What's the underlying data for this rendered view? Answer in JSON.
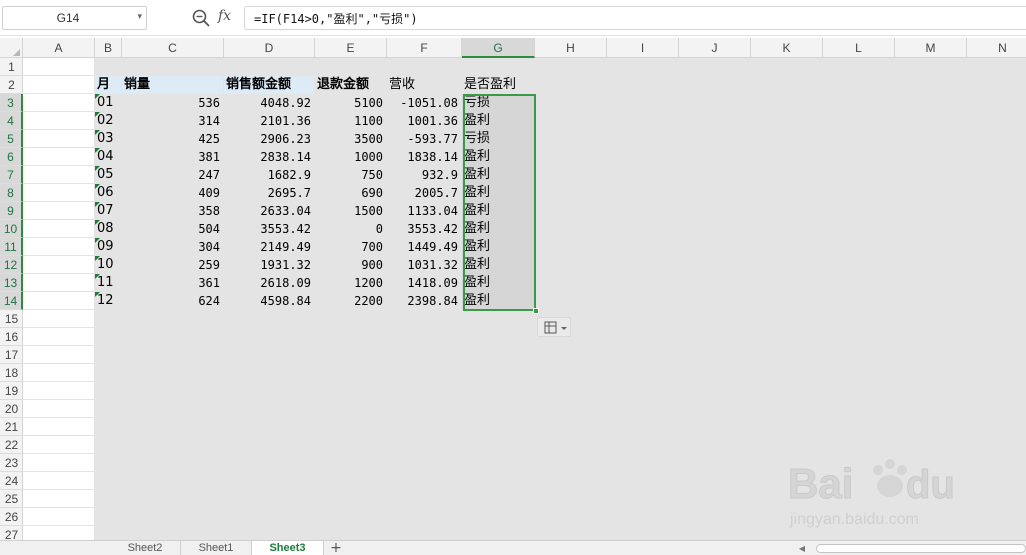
{
  "formula_bar": {
    "name_box": "G14",
    "fx_label": "fx",
    "formula": "=IF(F14>0,\"盈利\",\"亏损\")"
  },
  "columns": [
    "A",
    "B",
    "C",
    "D",
    "E",
    "F",
    "G",
    "H",
    "I",
    "J",
    "K",
    "L",
    "M",
    "N"
  ],
  "rows": [
    "1",
    "2",
    "3",
    "4",
    "5",
    "6",
    "7",
    "8",
    "9",
    "10",
    "11",
    "12",
    "13",
    "14",
    "15",
    "16",
    "17",
    "18",
    "19",
    "20",
    "21",
    "22",
    "23",
    "24",
    "25",
    "26",
    "27"
  ],
  "selected": {
    "column": "G",
    "rows": [
      "3",
      "4",
      "5",
      "6",
      "7",
      "8",
      "9",
      "10",
      "11",
      "12",
      "13",
      "14"
    ]
  },
  "table": {
    "headers": {
      "month": "月",
      "sales_qty": "销量",
      "sales_amount": "销售额金额",
      "refund_amount": "退款金额",
      "revenue": "营收",
      "is_profit": "是否盈利"
    },
    "records": [
      {
        "month": "01",
        "qty": "536",
        "sales": "4048.92",
        "refund": "5100",
        "revenue": "-1051.08",
        "profit": "亏损"
      },
      {
        "month": "02",
        "qty": "314",
        "sales": "2101.36",
        "refund": "1100",
        "revenue": "1001.36",
        "profit": "盈利"
      },
      {
        "month": "03",
        "qty": "425",
        "sales": "2906.23",
        "refund": "3500",
        "revenue": "-593.77",
        "profit": "亏损"
      },
      {
        "month": "04",
        "qty": "381",
        "sales": "2838.14",
        "refund": "1000",
        "revenue": "1838.14",
        "profit": "盈利"
      },
      {
        "month": "05",
        "qty": "247",
        "sales": "1682.9",
        "refund": "750",
        "revenue": "932.9",
        "profit": "盈利"
      },
      {
        "month": "06",
        "qty": "409",
        "sales": "2695.7",
        "refund": "690",
        "revenue": "2005.7",
        "profit": "盈利"
      },
      {
        "month": "07",
        "qty": "358",
        "sales": "2633.04",
        "refund": "1500",
        "revenue": "1133.04",
        "profit": "盈利"
      },
      {
        "month": "08",
        "qty": "504",
        "sales": "3553.42",
        "refund": "0",
        "revenue": "3553.42",
        "profit": "盈利"
      },
      {
        "month": "09",
        "qty": "304",
        "sales": "2149.49",
        "refund": "700",
        "revenue": "1449.49",
        "profit": "盈利"
      },
      {
        "month": "10",
        "qty": "259",
        "sales": "1931.32",
        "refund": "900",
        "revenue": "1031.32",
        "profit": "盈利"
      },
      {
        "month": "11",
        "qty": "361",
        "sales": "2618.09",
        "refund": "1200",
        "revenue": "1418.09",
        "profit": "盈利"
      },
      {
        "month": "12",
        "qty": "624",
        "sales": "4598.84",
        "refund": "2200",
        "revenue": "2398.84",
        "profit": "盈利"
      }
    ]
  },
  "sheet_tabs": [
    {
      "label": "Sheet2",
      "active": false
    },
    {
      "label": "Sheet1",
      "active": false
    },
    {
      "label": "Sheet3",
      "active": true
    }
  ],
  "add_sheet_label": "+",
  "watermark": {
    "brand": "Baidu经验",
    "url": "jingyan.baidu.com"
  },
  "colors": {
    "accent": "#217346",
    "selection_border": "#3a9a46",
    "header_fill": "#ddebf7"
  }
}
